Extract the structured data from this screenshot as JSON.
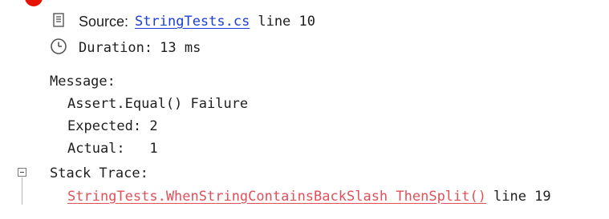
{
  "header": {
    "source_label": "Source:",
    "source_file": "StringTests.cs",
    "source_line": "line 10",
    "duration_label": "Duration:",
    "duration_value": "13 ms"
  },
  "message": {
    "label": "Message:",
    "lines": [
      "Assert.Equal() Failure",
      "Expected: 2",
      "Actual:   1"
    ]
  },
  "stack_trace": {
    "label": "Stack Trace:",
    "frame": "StringTests.WhenStringContainsBackSlash ThenSplit()",
    "frame_line": "line 19"
  },
  "colors": {
    "link": "#1a3fd6",
    "error_link": "#e0505a",
    "fail_icon": "#e51400"
  },
  "icons": [
    "fail-status-icon",
    "source-file-icon",
    "clock-icon",
    "collapse-icon"
  ]
}
